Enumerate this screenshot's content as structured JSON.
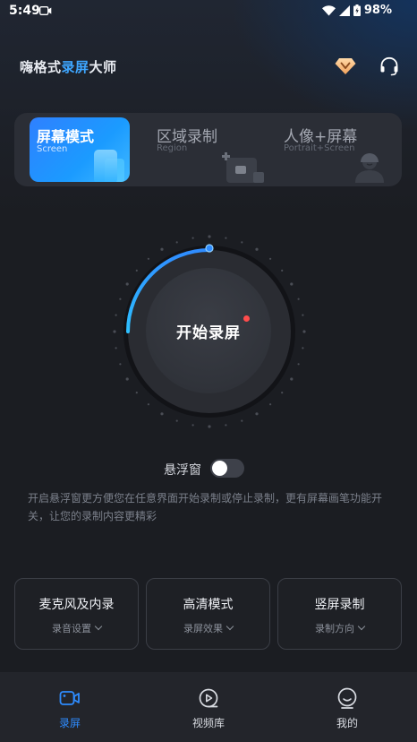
{
  "status_bar": {
    "time": "5:49",
    "battery": "98%"
  },
  "header": {
    "title_part1": "嗨格式",
    "title_part2": "录屏",
    "title_part3": "大师"
  },
  "modes": [
    {
      "label": "屏幕模式",
      "sublabel": "Screen",
      "active": true
    },
    {
      "label": "区域录制",
      "sublabel": "Region",
      "active": false
    },
    {
      "label": "人像+屏幕",
      "sublabel": "Portrait+Screen",
      "active": false
    }
  ],
  "record": {
    "start_label": "开始录屏",
    "accent": "#2f8cff"
  },
  "floating_window": {
    "label": "悬浮窗",
    "enabled": false,
    "description": "开启悬浮窗更方便您在任意界面开始录制或停止录制，更有屏幕画笔功能开关，让您的录制内容更精彩"
  },
  "options": [
    {
      "title": "麦克风及内录",
      "subtitle": "录音设置"
    },
    {
      "title": "高清模式",
      "subtitle": "录屏效果"
    },
    {
      "title": "竖屏录制",
      "subtitle": "录制方向"
    }
  ],
  "bottom_nav": [
    {
      "label": "录屏",
      "icon": "record-camera-icon",
      "active": true
    },
    {
      "label": "视频库",
      "icon": "video-library-icon",
      "active": false
    },
    {
      "label": "我的",
      "icon": "profile-icon",
      "active": false
    }
  ]
}
